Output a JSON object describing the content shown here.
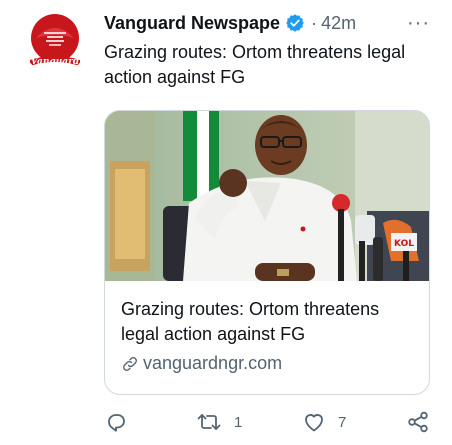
{
  "author": {
    "name": "Vanguard Newspape",
    "verified_icon": "verified-badge-icon",
    "separator": "·",
    "time": "42m",
    "avatar_text": "Vanguard"
  },
  "tweet": {
    "text": "Grazing routes: Ortom threatens legal action against FG"
  },
  "card": {
    "title": "Grazing routes: Ortom threatens legal action against FG",
    "domain": "vanguardngr.com",
    "link_icon": "link-icon",
    "mic_label": "KOL"
  },
  "actions": {
    "reply": {
      "icon": "reply-icon",
      "count": ""
    },
    "retweet": {
      "icon": "retweet-icon",
      "count": "1"
    },
    "like": {
      "icon": "heart-icon",
      "count": "7"
    },
    "share": {
      "icon": "share-icon"
    }
  },
  "menu": {
    "icon": "more-icon",
    "label": "···"
  },
  "colors": {
    "text": "#0f1419",
    "secondary": "#536471",
    "verified": "#1d9bf0",
    "border": "#cfd9de",
    "brand_red": "#d32027"
  }
}
